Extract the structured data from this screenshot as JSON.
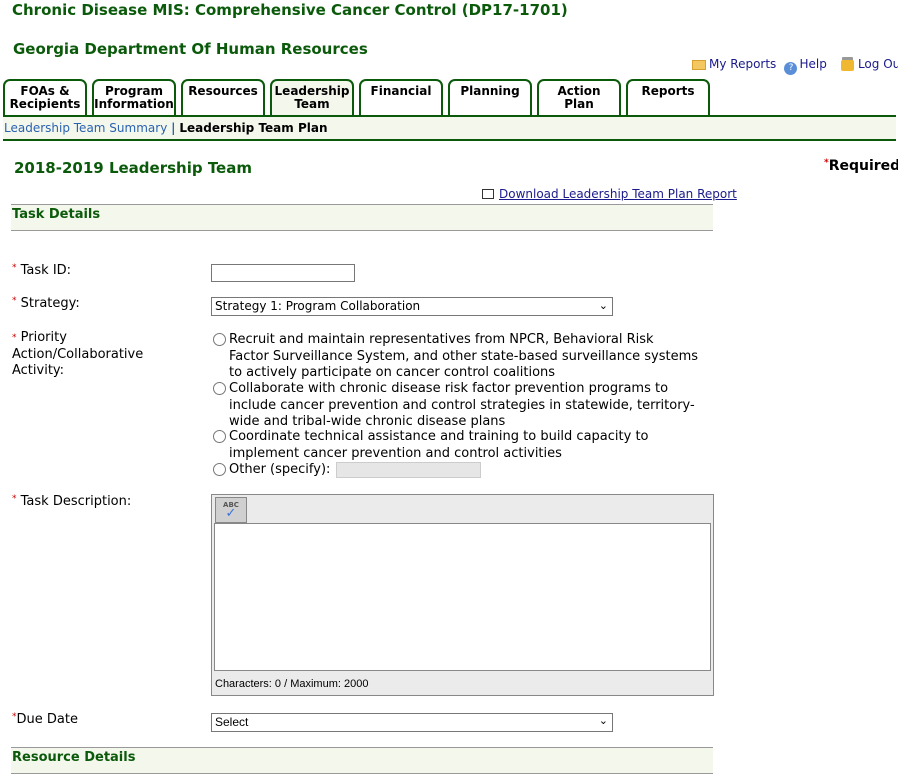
{
  "header": {
    "app_title": "Chronic Disease MIS: Comprehensive Cancer Control (DP17-1701)",
    "org": "Georgia Department Of Human Resources"
  },
  "topnav": {
    "my_reports": "My Reports",
    "help": "Help",
    "logout": "Log Out"
  },
  "tabs": [
    {
      "l1": "FOAs &",
      "l2": "Recipients"
    },
    {
      "l1": "Program",
      "l2": "Information"
    },
    {
      "l1": "Resources",
      "l2": ""
    },
    {
      "l1": "Leadership",
      "l2": "Team"
    },
    {
      "l1": "Financial",
      "l2": ""
    },
    {
      "l1": "Planning",
      "l2": ""
    },
    {
      "l1": "Action",
      "l2": "Plan"
    },
    {
      "l1": "Reports",
      "l2": ""
    }
  ],
  "subnav": {
    "summary": "Leadership Team Summary",
    "sep": "|",
    "current": "Leadership Team Plan"
  },
  "page": {
    "title": "2018-2019 Leadership Team",
    "required": "Required",
    "req_mark": "*",
    "download": "Download Leadership Team Plan Report"
  },
  "task": {
    "section": "Task Details",
    "task_id_label": "Task ID:",
    "task_id_value": "",
    "strategy_label": "Strategy:",
    "strategy_value": "Strategy 1: Program Collaboration",
    "priority_label_1": "Priority",
    "priority_label_2": "Action/Collaborative",
    "priority_label_3": "Activity:",
    "options": [
      {
        "lines": [
          "Recruit and maintain representatives from NPCR, Behavioral Risk",
          "Factor Surveillance System, and other state-based surveillance systems",
          "to actively participate on cancer control coalitions"
        ]
      },
      {
        "lines": [
          "Collaborate with chronic disease risk factor prevention programs to",
          "include cancer prevention and control strategies in statewide, territory-",
          "wide and tribal-wide chronic disease plans"
        ]
      },
      {
        "lines": [
          "Coordinate technical assistance and training to build capacity to",
          "implement cancer prevention and control activities"
        ]
      },
      {
        "lines": [
          "Other (specify):"
        ]
      }
    ],
    "description_label": "Task Description:",
    "description_value": "",
    "spell_icon_text": "ABC",
    "char_count": "Characters: 0 / Maximum: 2000",
    "due_label": "Due Date",
    "due_value": "Select"
  },
  "resource": {
    "section": "Resource Details"
  }
}
